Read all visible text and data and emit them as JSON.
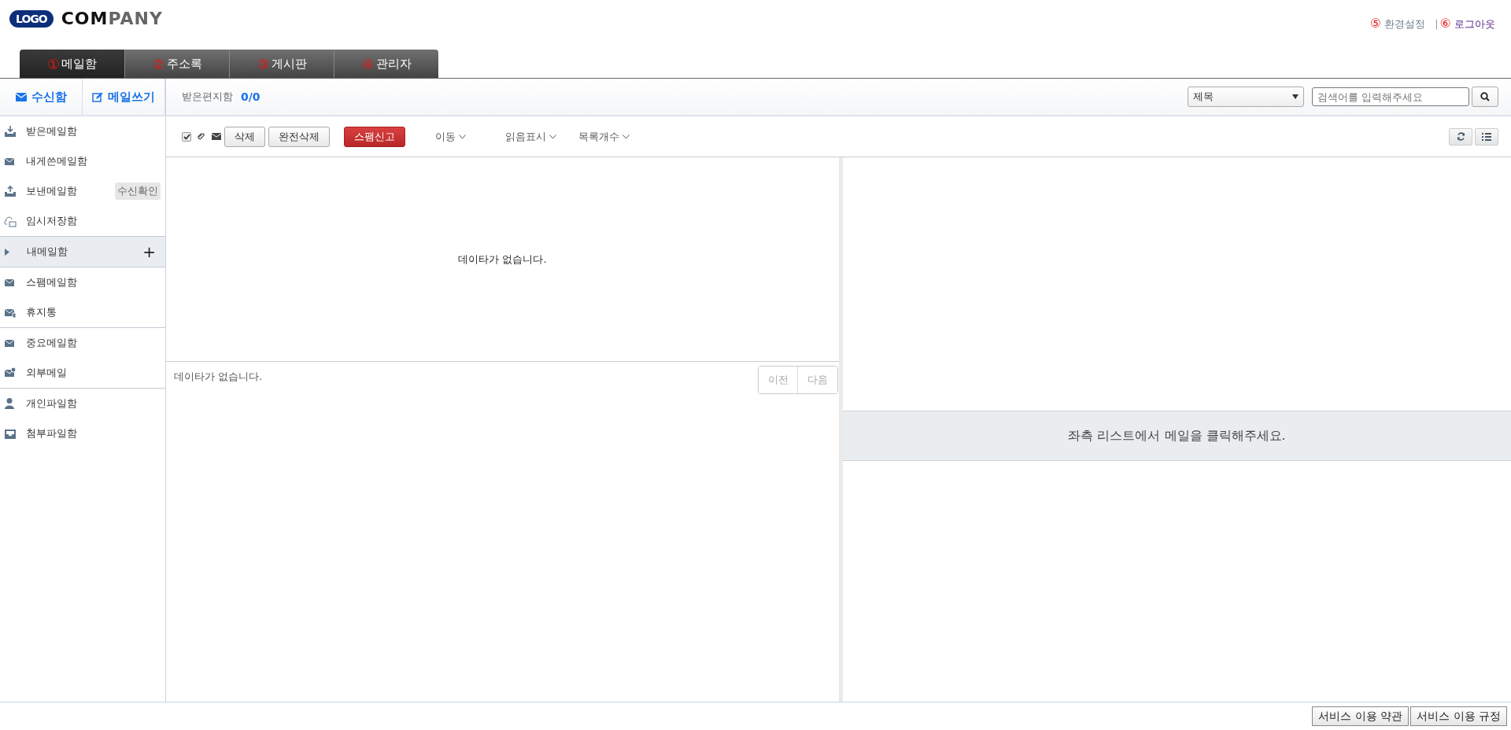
{
  "logo": {
    "mark": "LOGO",
    "brand": [
      "COM",
      "PANY"
    ]
  },
  "top_links": [
    {
      "number": "⑤",
      "label": "환경설정",
      "kind": "settings"
    },
    {
      "number": "⑥",
      "label": "로그아웃",
      "kind": "logout"
    }
  ],
  "top_separator": "|",
  "tabs": [
    {
      "number": "①",
      "label": "메일함",
      "selected": true
    },
    {
      "number": "②",
      "label": "주소록",
      "selected": false
    },
    {
      "number": "③",
      "label": "게시판",
      "selected": false
    },
    {
      "number": "④",
      "label": "관리자",
      "selected": false
    }
  ],
  "side_buttons": [
    {
      "label": "수신함",
      "kind": "inbox"
    },
    {
      "label": "메일쓰기",
      "kind": "compose"
    }
  ],
  "folder_title": "받은편지함",
  "folder_count": "0/0",
  "search": {
    "field": "제목",
    "placeholder": "검색어를 입력해주세요"
  },
  "sidebar": [
    [
      {
        "label": "받은메일함",
        "kind": "item"
      },
      {
        "label": "내게쓴메일함",
        "kind": "item"
      },
      {
        "label": "보낸메일함",
        "kind": "item",
        "badge": "수신확인"
      },
      {
        "label": "임시저장함",
        "kind": "item"
      }
    ],
    [
      {
        "label": "내메일함",
        "kind": "folder",
        "expanded": false,
        "add": "+"
      }
    ],
    [
      {
        "label": "스팸메일함",
        "kind": "item"
      },
      {
        "label": "휴지통",
        "kind": "item"
      }
    ],
    [
      {
        "label": "중요메일함",
        "kind": "item"
      },
      {
        "label": "외부메일",
        "kind": "item"
      }
    ],
    [
      {
        "label": "개인파일함",
        "kind": "item"
      },
      {
        "label": "첨부파일함",
        "kind": "item"
      }
    ]
  ],
  "toolbar": {
    "checked": true,
    "buttons": [
      {
        "label": "삭제",
        "kind": "plain"
      },
      {
        "label": "완전삭제",
        "kind": "plain"
      },
      {
        "label": "스팸신고",
        "kind": "danger"
      }
    ],
    "menus": [
      "이동",
      "읽음표시",
      "목록개수"
    ]
  },
  "list_empty": "데이타가 없습니다.",
  "list_footer_empty": "데이타가 없습니다.",
  "pager": [
    {
      "label": "이전",
      "disabled": true
    },
    {
      "label": "다음",
      "disabled": true
    }
  ],
  "preview_message": "좌측 리스트에서 메일을 클릭해주세요.",
  "footer_buttons": [
    "서비스 이용 약관",
    "서비스 이용 규정"
  ]
}
